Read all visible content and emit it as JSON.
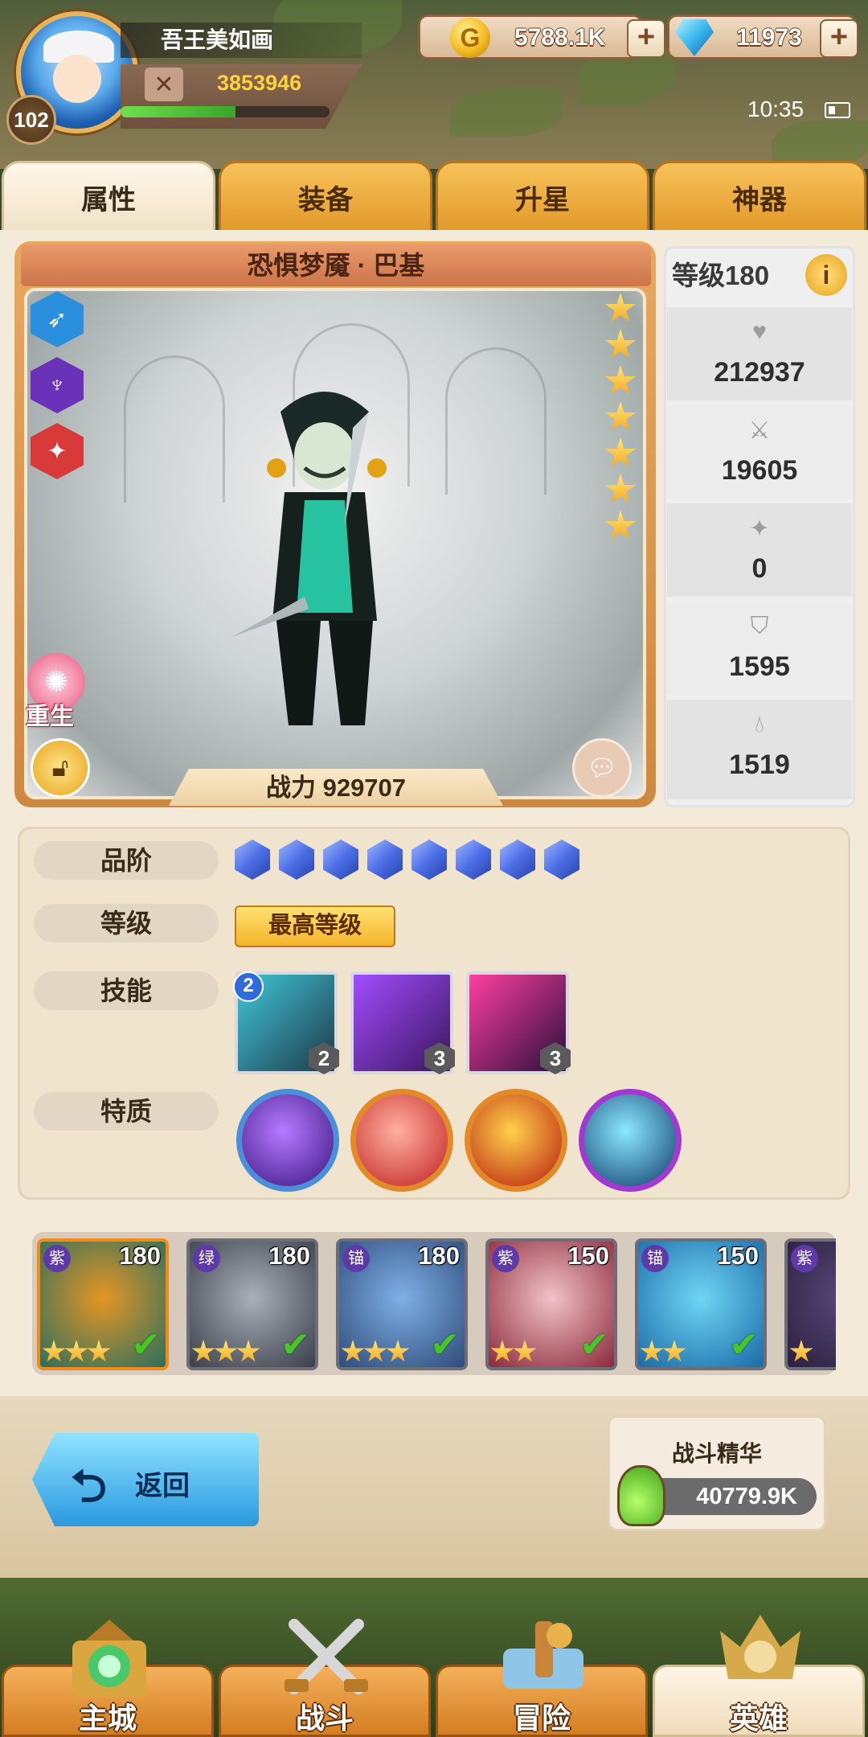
{
  "player": {
    "name": "吾王美如画",
    "power": "3853946",
    "level": "102",
    "xp_fraction": 0.55
  },
  "currency": {
    "gold": "5788.1K",
    "gems": "11973",
    "plus": "+"
  },
  "status": {
    "time": "10:35"
  },
  "tabs": [
    "属性",
    "装备",
    "升星",
    "神器"
  ],
  "hero": {
    "name": "恐惧梦魇 · 巴基",
    "combat_power": "战力 929707",
    "stars": 7,
    "rebirth_label": "重生"
  },
  "stats": {
    "level": "等级180",
    "info": "i",
    "hp": "212937",
    "attack": "19605",
    "crit": "0",
    "defense": "1595",
    "speed": "1519"
  },
  "attributes": {
    "rank_label": "品阶",
    "rank_count": 8,
    "level_label": "等级",
    "level_value": "最高等级",
    "skill_label": "技能",
    "skills": [
      {
        "name": "skill-1",
        "level": "2",
        "badge": "2",
        "colors": [
          "#1f3a4a",
          "#3fc7d8"
        ]
      },
      {
        "name": "skill-2",
        "level": "3",
        "colors": [
          "#3a1660",
          "#a34cff"
        ]
      },
      {
        "name": "skill-3",
        "level": "3",
        "colors": [
          "#2a0f3a",
          "#ff3fa0"
        ]
      }
    ],
    "trait_label": "特质",
    "traits": [
      {
        "name": "trait-purple-prism",
        "ring": "#4b8fd8",
        "colors": [
          "#b67bff",
          "#3a1480"
        ]
      },
      {
        "name": "trait-red-slash",
        "ring": "#e38a28",
        "colors": [
          "#ffb0a0",
          "#c02020"
        ]
      },
      {
        "name": "trait-gold-shield",
        "ring": "#e38a28",
        "colors": [
          "#ffd24a",
          "#b81a10"
        ]
      },
      {
        "name": "trait-blue-lightning",
        "ring": "#a23ad0",
        "colors": [
          "#8ce8ff",
          "#0d3b6a"
        ]
      }
    ]
  },
  "roster": [
    {
      "level": "180",
      "faction": "紫",
      "stars": 3,
      "colors": [
        "#e59624",
        "#2a6f5e"
      ],
      "active": true
    },
    {
      "level": "180",
      "faction": "绿",
      "stars": 3,
      "colors": [
        "#a9b0b8",
        "#3a3f4a"
      ]
    },
    {
      "level": "180",
      "faction": "锚",
      "stars": 3,
      "colors": [
        "#7fb0e6",
        "#2e4c7a"
      ]
    },
    {
      "level": "150",
      "faction": "紫",
      "stars": 2,
      "colors": [
        "#f3c2c8",
        "#8a2a3a"
      ]
    },
    {
      "level": "150",
      "faction": "锚",
      "stars": 2,
      "colors": [
        "#6fd6f4",
        "#1a6aa8"
      ]
    },
    {
      "level": "",
      "faction": "紫",
      "stars": 1,
      "colors": [
        "#5a4a7a",
        "#2a2040"
      ]
    }
  ],
  "footer": {
    "back": "返回",
    "essence_title": "战斗精华",
    "essence_value": "40779.9K"
  },
  "nav": [
    "主城",
    "战斗",
    "冒险",
    "英雄"
  ]
}
